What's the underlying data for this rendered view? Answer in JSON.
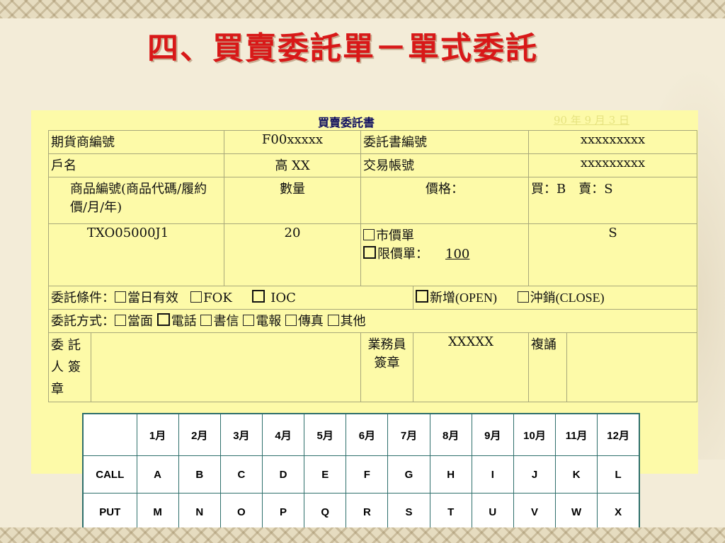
{
  "title": "四、買賣委託單－單式委託",
  "form": {
    "heading": "買賣委託書",
    "date": "90 年 9 月 3 日",
    "row1": {
      "label_a": "期貨商編號",
      "value_a": "F00xxxxx",
      "label_b": "委託書編號",
      "value_b": "xxxxxxxxx"
    },
    "row2": {
      "label_a": "戶名",
      "value_a": "高 XX",
      "label_b": "交易帳號",
      "value_b": "xxxxxxxxx"
    },
    "row3": {
      "product_label": "商品編號(商品代碼/履約價/月/年)",
      "qty_label": "數量",
      "price_label": "價格：",
      "side_label": "買：B　賣：S"
    },
    "row4": {
      "product_code": "TXO05000J1",
      "qty": "20",
      "market_label": "市價單",
      "limit_label": "限價單：",
      "limit_value": "100",
      "side": "S"
    },
    "conditions": {
      "label": "委託條件：",
      "rod": "當日有效",
      "fok": "FOK",
      "ioc": "IOC",
      "open": "新增(OPEN)",
      "close": "沖銷(CLOSE)"
    },
    "methods": {
      "label": "委託方式：",
      "items": [
        "當面",
        "電話",
        "書信",
        "電報",
        "傳真",
        "其他"
      ]
    },
    "sign": {
      "client_label": "委託人簽章",
      "agent_label": "業務員簽章",
      "agent_value": "XXXXX",
      "recite_label": "複誦"
    }
  },
  "months_table": {
    "headers": [
      "",
      "1月",
      "2月",
      "3月",
      "4月",
      "5月",
      "6月",
      "7月",
      "8月",
      "9月",
      "10月",
      "11月",
      "12月"
    ],
    "rows": [
      {
        "label": "CALL",
        "codes": [
          "A",
          "B",
          "C",
          "D",
          "E",
          "F",
          "G",
          "H",
          "I",
          "J",
          "K",
          "L"
        ]
      },
      {
        "label": "PUT",
        "codes": [
          "M",
          "N",
          "O",
          "P",
          "Q",
          "R",
          "S",
          "T",
          "U",
          "V",
          "W",
          "X"
        ]
      }
    ]
  }
}
